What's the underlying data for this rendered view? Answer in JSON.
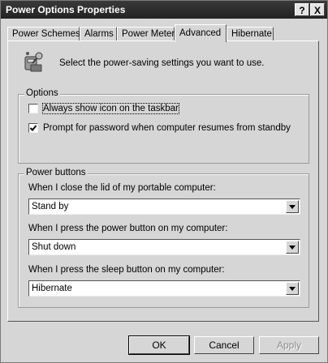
{
  "window": {
    "title": "Power Options Properties",
    "help_button": "?",
    "close_button": "X"
  },
  "tabs": [
    {
      "label": "Power Schemes",
      "active": false
    },
    {
      "label": "Alarms",
      "active": false
    },
    {
      "label": "Power Meter",
      "active": false
    },
    {
      "label": "Advanced",
      "active": true
    },
    {
      "label": "Hibernate",
      "active": false
    }
  ],
  "header": {
    "text": "Select the power-saving settings you want to use.",
    "icon": "power-settings-icon"
  },
  "options": {
    "legend": "Options",
    "always_show_icon": {
      "label": "Always show icon on the taskbar",
      "checked": false
    },
    "prompt_password": {
      "label": "Prompt for password when computer resumes from standby",
      "checked": true
    }
  },
  "power_buttons": {
    "legend": "Power buttons",
    "lid_label": "When I close the lid of my portable computer:",
    "lid_value": "Stand by",
    "power_label": "When I press the power button on my computer:",
    "power_value": "Shut down",
    "sleep_label": "When I press the sleep button on my computer:",
    "sleep_value": "Hibernate"
  },
  "buttons": {
    "ok": "OK",
    "cancel": "Cancel",
    "apply": "Apply"
  }
}
